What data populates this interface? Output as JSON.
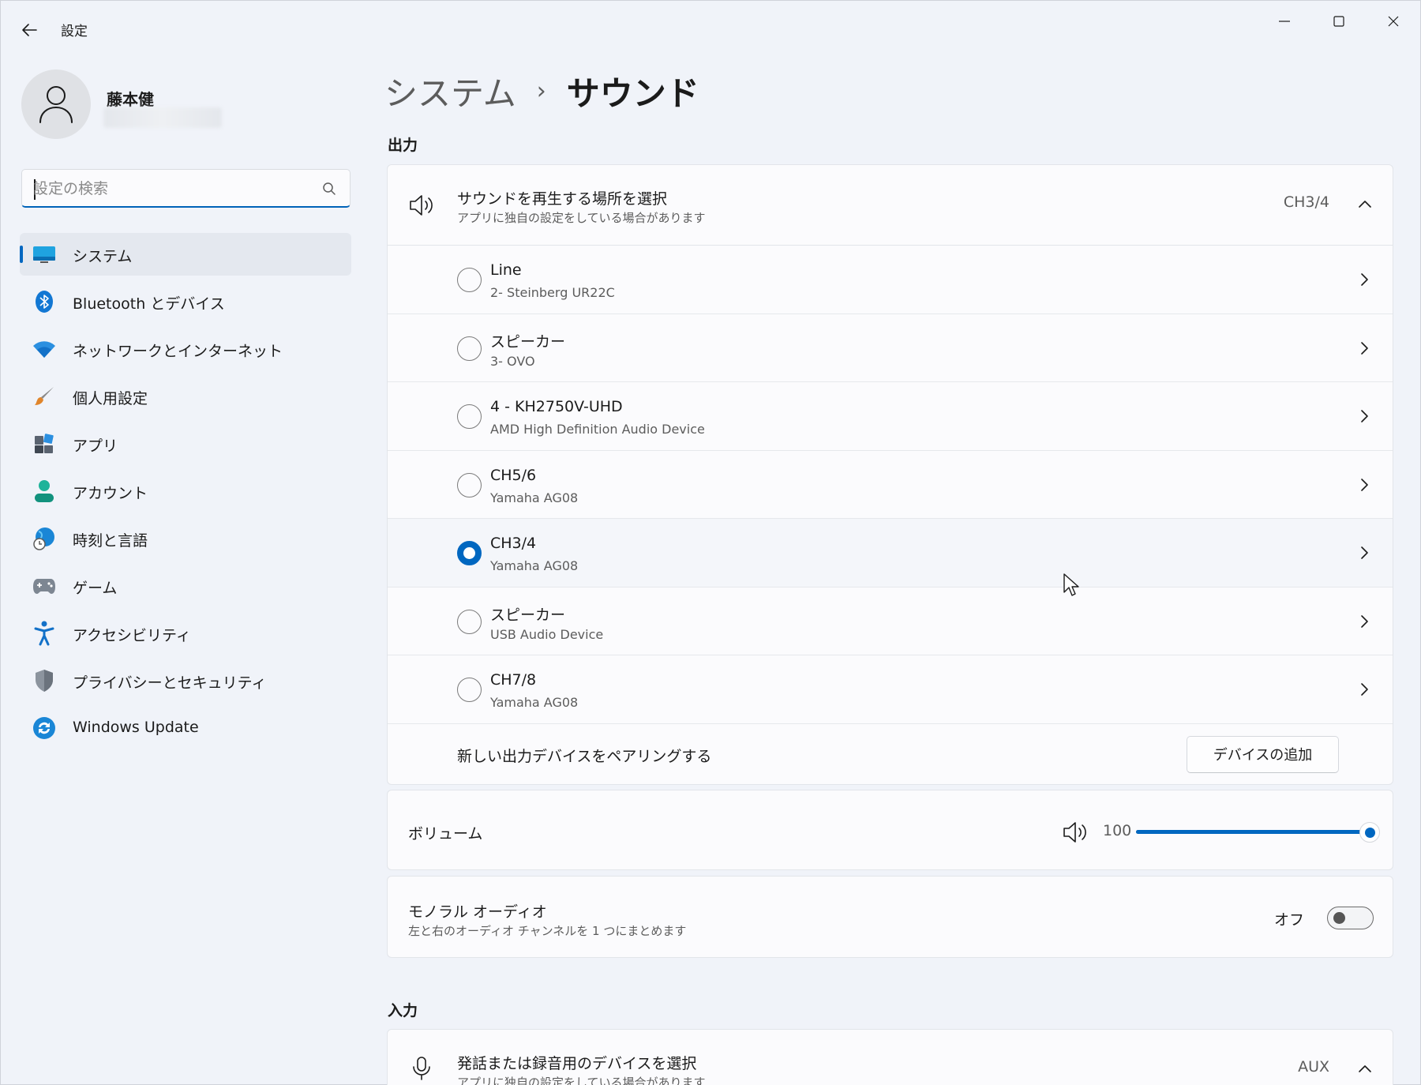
{
  "window": {
    "title": "設定"
  },
  "user": {
    "name": "藤本健"
  },
  "search": {
    "placeholder": "設定の検索"
  },
  "nav": [
    {
      "label": "システム",
      "icon": "system-display-icon",
      "active": true
    },
    {
      "label": "Bluetooth とデバイス",
      "icon": "bluetooth-icon"
    },
    {
      "label": "ネットワークとインターネット",
      "icon": "wifi-icon"
    },
    {
      "label": "個人用設定",
      "icon": "paintbrush-icon"
    },
    {
      "label": "アプリ",
      "icon": "apps-icon"
    },
    {
      "label": "アカウント",
      "icon": "account-icon"
    },
    {
      "label": "時刻と言語",
      "icon": "globe-clock-icon"
    },
    {
      "label": "ゲーム",
      "icon": "gamepad-icon"
    },
    {
      "label": "アクセシビリティ",
      "icon": "accessibility-icon"
    },
    {
      "label": "プライバシーとセキュリティ",
      "icon": "shield-icon"
    },
    {
      "label": "Windows Update",
      "icon": "windows-update-icon"
    }
  ],
  "breadcrumb": {
    "parent": "システム",
    "separator": "›",
    "current": "サウンド"
  },
  "output": {
    "section_title": "出力",
    "header": {
      "title": "サウンドを再生する場所を選択",
      "subtitle": "アプリに独自の設定をしている場合があります",
      "value": "CH3/4"
    },
    "devices": [
      {
        "name": "Line",
        "sub": "2- Steinberg UR22C",
        "selected": false
      },
      {
        "name": "スピーカー",
        "sub": "3- OVO",
        "selected": false
      },
      {
        "name": "4 - KH2750V-UHD",
        "sub": "AMD High Definition Audio Device",
        "selected": false
      },
      {
        "name": "CH5/6",
        "sub": "Yamaha AG08",
        "selected": false
      },
      {
        "name": "CH3/4",
        "sub": "Yamaha AG08",
        "selected": true
      },
      {
        "name": "スピーカー",
        "sub": "USB Audio Device",
        "selected": false
      },
      {
        "name": "CH7/8",
        "sub": "Yamaha AG08",
        "selected": false
      }
    ],
    "pair": {
      "label": "新しい出力デバイスをペアリングする",
      "button": "デバイスの追加"
    }
  },
  "volume": {
    "label": "ボリューム",
    "value": "100",
    "level_percent": 100
  },
  "mono": {
    "title": "モノラル オーディオ",
    "subtitle": "左と右のオーディオ チャンネルを 1 つにまとめます",
    "state": "オフ"
  },
  "input": {
    "section_title": "入力",
    "header": {
      "title": "発話または録音用のデバイスを選択",
      "subtitle": "アプリに独自の設定をしている場合があります",
      "value": "AUX"
    }
  },
  "colors": {
    "accent": "#0067c0",
    "background": "#f0f3f9",
    "card": "#fbfbfd"
  }
}
